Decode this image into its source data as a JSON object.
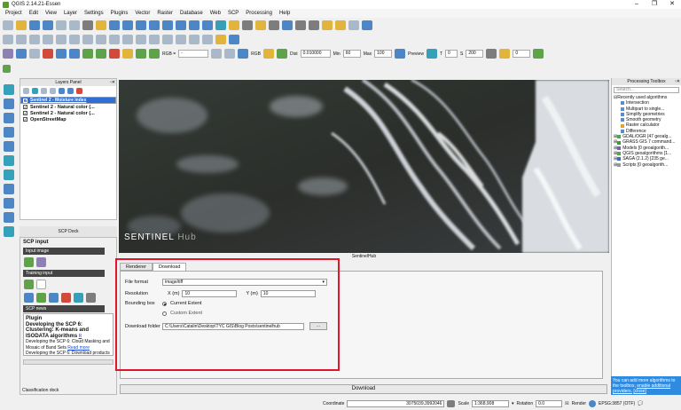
{
  "window": {
    "title": "QGIS 2.14.21-Essen",
    "controls": [
      "–",
      "❐",
      "✕"
    ]
  },
  "menu": [
    "Project",
    "Edit",
    "View",
    "Layer",
    "Settings",
    "Plugins",
    "Vector",
    "Raster",
    "Database",
    "Web",
    "SCP",
    "Processing",
    "Help"
  ],
  "toolbar3": {
    "band_label": "RGB =",
    "band_value": "-",
    "rgb_label": "RGB",
    "dist_label": "Dist",
    "dist_value": "0.010000",
    "min_label": "Min",
    "min_value": "60",
    "max_label": "Max",
    "max_value": "100",
    "preview_label": "Preview",
    "t_label": "T",
    "t_value": "0",
    "s_label": "S",
    "s_value": "200",
    "n_value": "0"
  },
  "layers_panel": {
    "title": "Layers Panel",
    "layers": [
      {
        "name": "Sentinel 2 - Moisture index",
        "checked": true,
        "selected": true
      },
      {
        "name": "Sentinel 2 - Natural color (...",
        "checked": true,
        "selected": false
      },
      {
        "name": "Sentinel 2 - Natural color (...",
        "checked": true,
        "selected": false
      },
      {
        "name": "OpenStreetMap",
        "checked": true,
        "selected": false
      }
    ]
  },
  "scp_dock": {
    "title": "SCP Dock",
    "tab": "SCP input",
    "input_image": "Input image",
    "training_input": "Training input",
    "scp_news": "SCP news",
    "news": {
      "heading": "Plugin",
      "item1": "Developing the SCP 6: Clustering: K-means and ISODATA algorithms",
      "item1_more": "R",
      "item2": "Developing the SCP 6: Cloud Masking and Mosaic of Band Sets",
      "item2_more": "Read more",
      "item3": "Developing the SCP 6: Download products"
    }
  },
  "classification_dock": "Classification dock",
  "map": {
    "logo_text": "SENTINEL",
    "logo_hub": "Hub"
  },
  "sentinelhub": {
    "title": "SentinelHub",
    "tabs": [
      "Renderer",
      "Download"
    ],
    "active_tab": "Download",
    "file_format_label": "File format",
    "file_format_value": "image/tiff",
    "resolution_label": "Resolution",
    "x_label": "X (m)",
    "x_value": "10",
    "y_label": "Y (m)",
    "y_value": "10",
    "bbox_label": "Bounding box",
    "bbox_opt1": "Current Extent",
    "bbox_opt2": "Custom Extent",
    "folder_label": "Download folder",
    "folder_value": "C:\\Users\\Catalin\\Desktop\\TYC GIS\\Blog Posts\\sentinelhub",
    "browse": "...",
    "download_button": "Download"
  },
  "processing_toolbox": {
    "title": "Processing Toolbox",
    "search_placeholder": "Search...",
    "items": [
      "Recently used algorithms",
      "Intersection",
      "Multipart to single...",
      "Simplify geometries",
      "Smooth geometry",
      "Raster calculator",
      "Difference",
      "GDAL/OGR [47 geoalg...",
      "GRASS GIS 7 command...",
      "Models [0 geoalgorith...",
      "QGIS geoalgorithms [1...",
      "SAGA (2.1.2) [235 ge...",
      "Scripts [0 geoalgorith..."
    ],
    "ad_text": "You can add more algorithms to the toolbox,",
    "ad_link1": "enable additional",
    "ad_link2": "providers.",
    "ad_close": "[close]"
  },
  "status": {
    "coord_label": "Coordinate",
    "coord_value": "3075039,3992046",
    "scale_label": "Scale",
    "scale_value": "1:368,908",
    "rotation_label": "Rotation",
    "rotation_value": "0.0",
    "render_label": "Render",
    "crs": "EPSG:3857 (OTF)"
  },
  "colors": {
    "highlight_box": "#e0162b",
    "selection": "#2f6ed6",
    "ad_bg": "#2f8be0"
  }
}
